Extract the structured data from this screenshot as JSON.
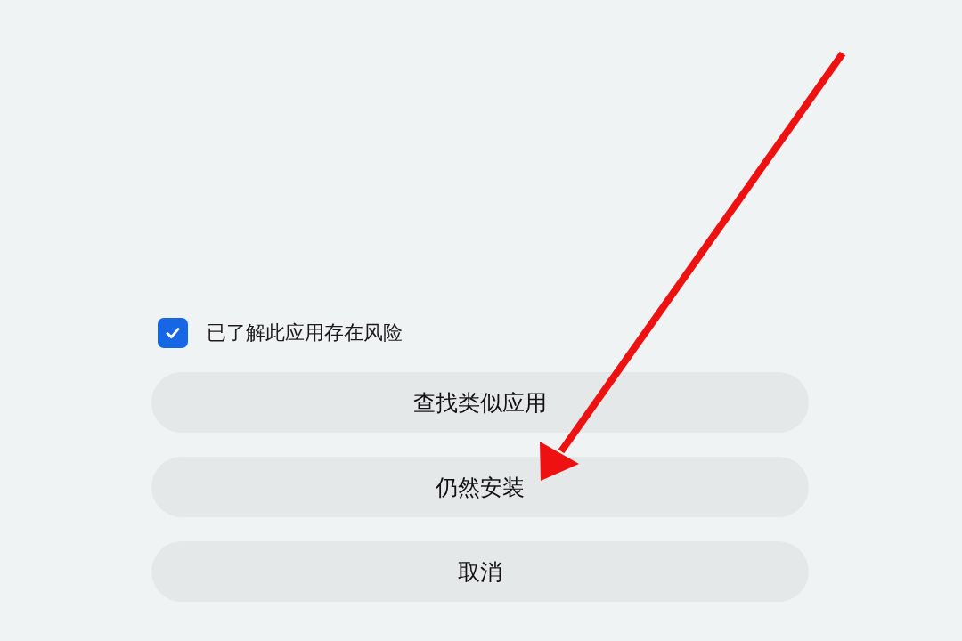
{
  "acknowledgement": {
    "label": "已了解此应用存在风险",
    "checked": true
  },
  "buttons": [
    {
      "label": "查找类似应用"
    },
    {
      "label": "仍然安装"
    },
    {
      "label": "取消"
    }
  ]
}
